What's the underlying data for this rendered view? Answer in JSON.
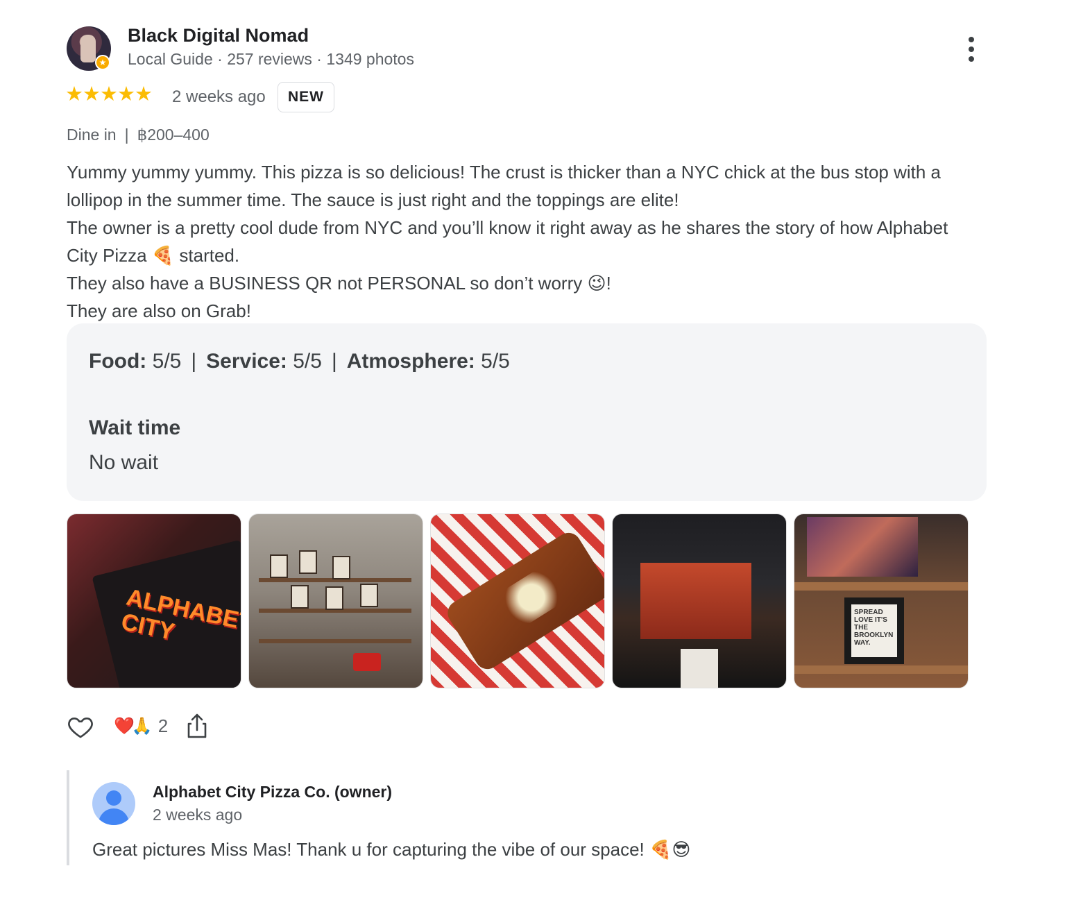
{
  "review": {
    "reviewer_name": "Black Digital Nomad",
    "reviewer_meta": "Local Guide · 257 reviews · 1349 photos",
    "rating": 5,
    "stars_text": "★★★★★",
    "date": "2 weeks ago",
    "badge": "NEW",
    "service_type": "Dine in",
    "price": "฿200–400",
    "text_lines": [
      "Yummy yummy yummy. This pizza is so delicious! The crust is thicker than a NYC chick at the bus stop with a lollipop in the summer time. The sauce is just right and the toppings are elite!",
      "The owner is a pretty cool dude from NYC and you’ll know it right away as he shares the story of how Alphabet City Pizza 🍕 started.",
      "They also have a BUSINESS QR not PERSONAL so don’t worry 😉!",
      "They are also on Grab!"
    ],
    "attributes": {
      "food_label": "Food:",
      "food_value": "5/5",
      "service_label": "Service:",
      "service_value": "5/5",
      "atmosphere_label": "Atmosphere:",
      "atmosphere_value": "5/5",
      "separator": "|",
      "wait_label": "Wait time",
      "wait_value": "No wait"
    },
    "photos": [
      {
        "name": "menu-photo",
        "logo_text": "ALPHABET CITY"
      },
      {
        "name": "interior-shelves-photo"
      },
      {
        "name": "pizza-photo"
      },
      {
        "name": "storefront-photo"
      },
      {
        "name": "wall-decor-photo",
        "frame_text": "SPREAD LOVE IT'S THE BROOKLYN WAY."
      }
    ],
    "actions": {
      "like_icon": "heart-outline-icon",
      "reaction_emojis": "❤️🙏",
      "reaction_count": "2",
      "share_icon": "share-icon"
    }
  },
  "owner_reply": {
    "name": "Alphabet City Pizza Co. (owner)",
    "date": "2 weeks ago",
    "text": "Great pictures Miss Mas! Thank u for capturing the vibe of our space! 🍕😎"
  },
  "colors": {
    "star": "#fbbc04",
    "panel_bg": "#f4f5f7",
    "text_primary": "#202124",
    "text_secondary": "#5f6368",
    "owner_avatar": "#4285f4"
  }
}
